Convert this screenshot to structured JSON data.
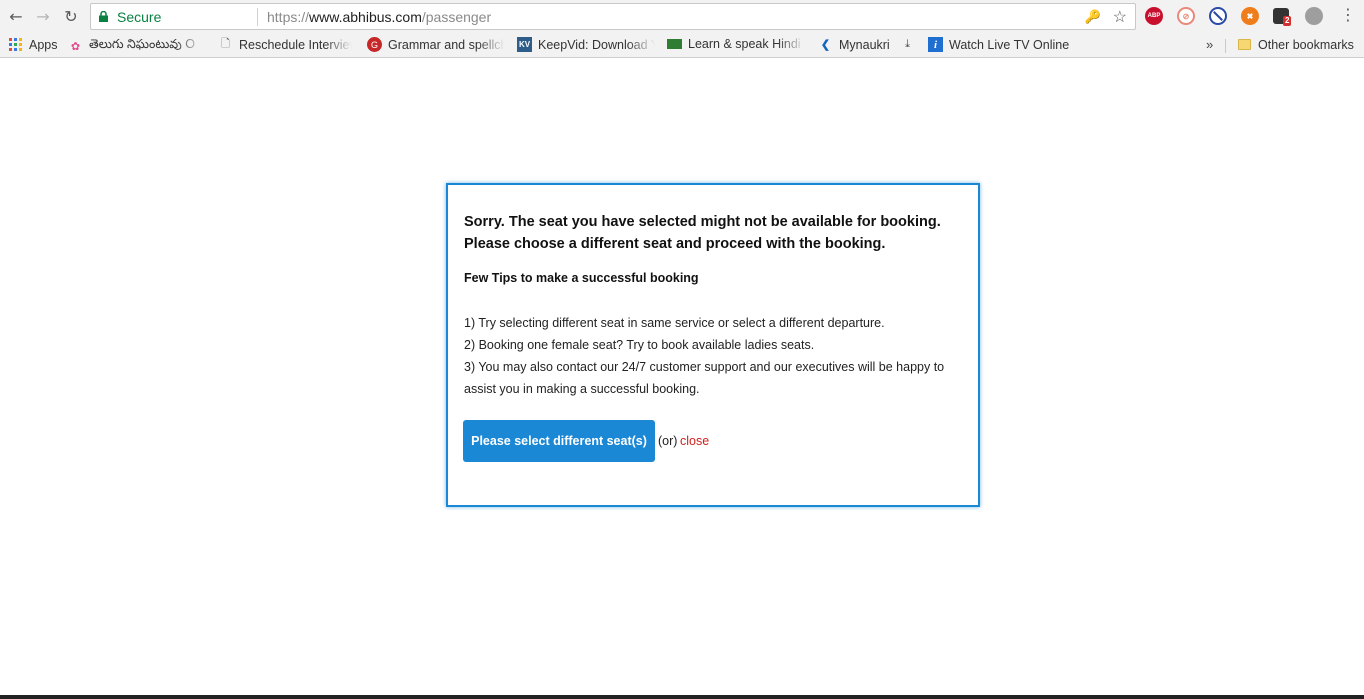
{
  "browser": {
    "omnibox": {
      "secure_label": "Secure",
      "url_scheme": "https://",
      "url_host": "www.abhibus.com",
      "url_path": "/passenger"
    },
    "extensions": {
      "abp_label": "ABP",
      "badge_count": "2"
    },
    "bookmarks": [
      {
        "label": "Apps",
        "icon": "apps-grid-icon"
      },
      {
        "label": "తెలుగు నిఘంటువు O",
        "icon": "telugu-dictionary-icon"
      },
      {
        "label": "Reschedule Interview",
        "icon": "page-icon"
      },
      {
        "label": "Grammar and spellche",
        "icon": "grammarly-icon"
      },
      {
        "label": "KeepVid: Download Yo",
        "icon": "keepvid-icon"
      },
      {
        "label": "Learn & speak Hindi c",
        "icon": "hindi-board-icon"
      },
      {
        "label": "Mynaukri",
        "icon": "mynaukri-icon"
      },
      {
        "label": "",
        "icon": "download-icon"
      },
      {
        "label": "Watch Live TV Online",
        "icon": "info-icon"
      }
    ],
    "other_bookmarks": "Other bookmarks",
    "colors": {
      "secure_green": "#0b8043",
      "toolbar_bg": "#f2f2f2"
    }
  },
  "dialog": {
    "heading": "Sorry. The seat you have selected might not be available for booking. Please choose a different seat and proceed with the booking.",
    "tips_title": "Few Tips to make a successful booking",
    "tips": [
      "1) Try selecting different seat in same service or select a different departure.",
      "2) Booking one female seat? Try to book available ladies seats.",
      "3) You may also contact our 24/7 customer support and our executives will be happy to assist you in making a successful booking."
    ],
    "primary_button": "Please select different seat(s)",
    "or_text": "(or)",
    "close_link": "close",
    "colors": {
      "accent": "#1b88d6",
      "close_red": "#d0211c"
    }
  }
}
